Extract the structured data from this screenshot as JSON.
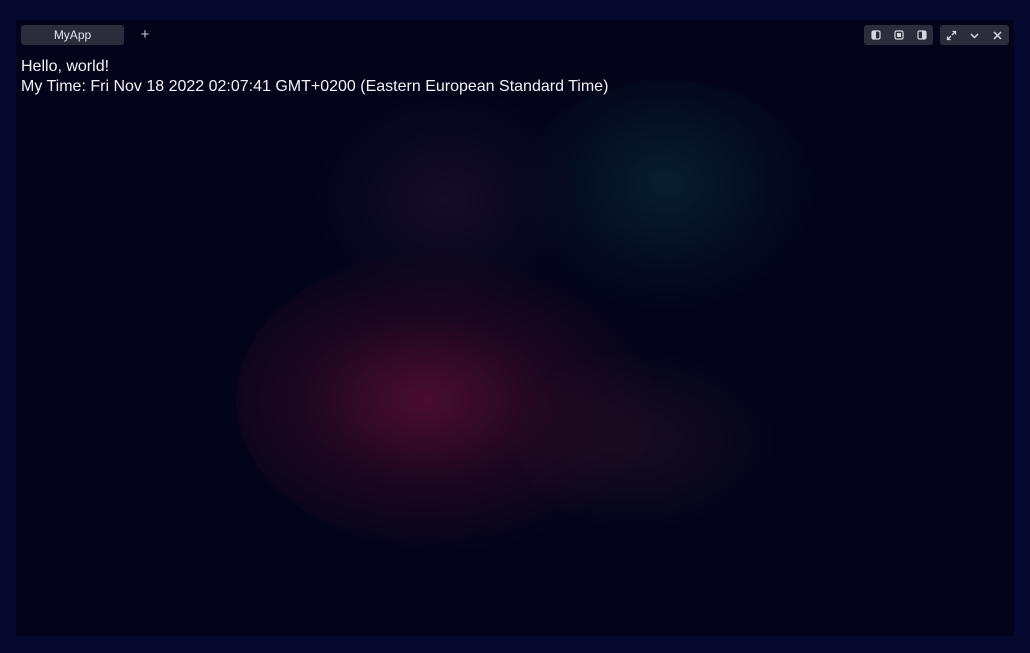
{
  "tab": {
    "label": "MyApp",
    "add_label": "+"
  },
  "toolbar": {
    "layout_icons": [
      "dock-left-icon",
      "dock-center-icon",
      "dock-right-icon"
    ],
    "window_icons": [
      "maximize-icon",
      "minimize-icon",
      "close-icon"
    ]
  },
  "content": {
    "greeting": "Hello, world!",
    "time_line": "My Time: Fri Nov 18 2022 02:07:41 GMT+0200 (Eastern European Standard Time)"
  },
  "colors": {
    "background": "#04072e",
    "window": "#03041a",
    "tab": "#2c2c3c",
    "text": "#f2f2f6",
    "glow_red": "#76123a",
    "glow_teal": "#0c3442"
  }
}
